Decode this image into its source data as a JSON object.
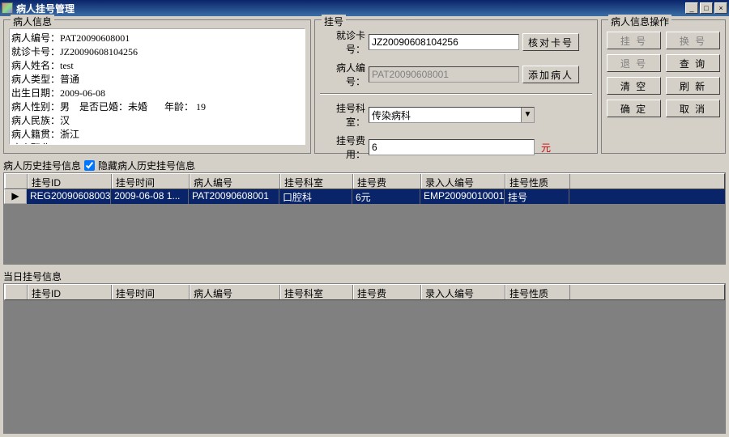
{
  "window": {
    "title": "病人挂号管理"
  },
  "patientInfo": {
    "legend": "病人信息",
    "text": "病人编号：PAT20090608001\n就诊卡号：JZ20090608104256\n病人姓名：test\n病人类型：普通\n出生日期：2009-06-08\n病人性别：男    是否已婚：未婚       年龄： 19\n病人民族：汉\n病人籍贯：浙江\n病人职业：xuesheng\n病人单位：adsfasd"
  },
  "register": {
    "legend": "挂号",
    "cardLabel": "就诊卡号：",
    "cardValue": "JZ20090608104256",
    "verifyCard": "核对卡号",
    "patNoLabel": "病人编号：",
    "patNoValue": "PAT20090608001",
    "addPatient": "添加病人",
    "deptLabel": "挂号科室：",
    "deptValue": "传染病科",
    "feeLabel": "挂号费用：",
    "feeValue": "6",
    "yuan": "元"
  },
  "ops": {
    "legend": "病人信息操作",
    "buttons": {
      "reg": "挂 号",
      "change": "换 号",
      "ret": "退 号",
      "query": "查 询",
      "clear": "清 空",
      "refresh": "刷 新",
      "ok": "确 定",
      "cancel": "取 消"
    }
  },
  "history": {
    "legend": "病人历史挂号信息",
    "hideLabel": "隐藏病人历史挂号信息",
    "columns": {
      "id": "挂号ID",
      "time": "挂号时间",
      "pat": "病人编号",
      "dept": "挂号科室",
      "fee": "挂号费",
      "emp": "录入人编号",
      "nature": "挂号性质"
    },
    "rows": [
      {
        "id": "REG20090608003",
        "time": "2009-06-08 1...",
        "pat": "PAT20090608001",
        "dept": "口腔科",
        "fee": "6元",
        "emp": "EMP20090010001",
        "nature": "挂号"
      }
    ]
  },
  "today": {
    "legend": "当日挂号信息",
    "columns": {
      "id": "挂号ID",
      "time": "挂号时间",
      "pat": "病人编号",
      "dept": "挂号科室",
      "fee": "挂号费",
      "emp": "录入人编号",
      "nature": "挂号性质"
    }
  }
}
